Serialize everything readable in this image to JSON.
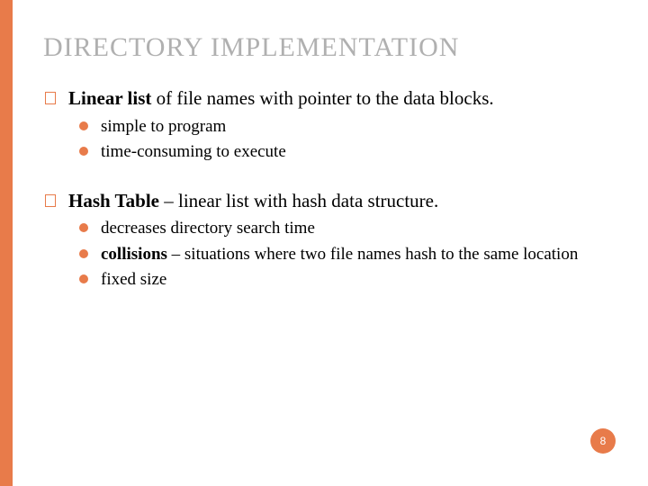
{
  "title": "DIRECTORY IMPLEMENTATION",
  "items": [
    {
      "lead_bold": "Linear list",
      "rest": " of file names with pointer to the data blocks.",
      "subs": [
        {
          "text": "simple to program"
        },
        {
          "text": "time-consuming to execute"
        }
      ]
    },
    {
      "lead_bold": "Hash Table",
      "rest": " – linear list with hash data structure.",
      "subs": [
        {
          "text": "decreases directory search time"
        },
        {
          "bold": "collisions",
          "rest": " – situations where two file names hash to the same location"
        },
        {
          "text": "fixed size"
        }
      ]
    }
  ],
  "page_number": "8"
}
